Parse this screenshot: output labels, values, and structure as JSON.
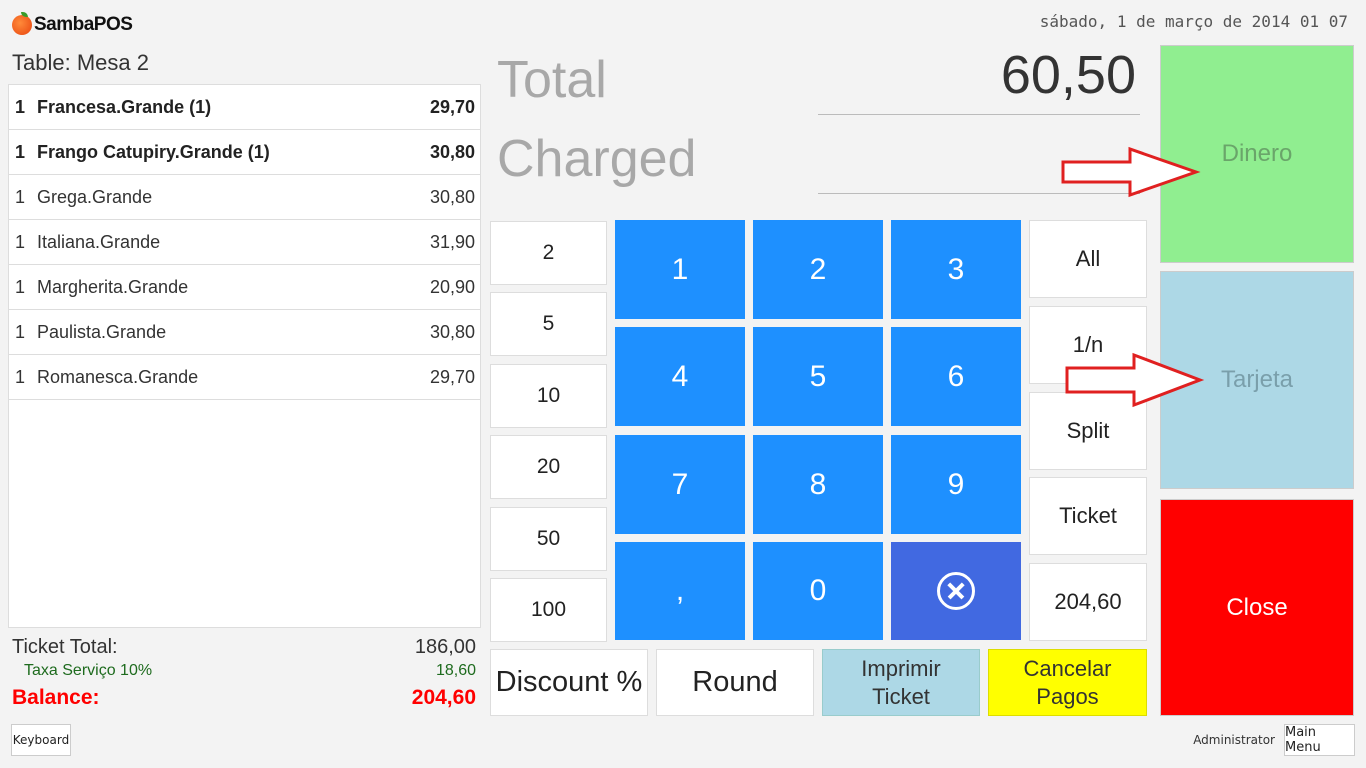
{
  "app": {
    "name": "SambaPOS",
    "datetime": "sábado, 1 de março de 2014 01 07"
  },
  "ticket": {
    "table_label": "Table: Mesa 2",
    "items": [
      {
        "qty": "1",
        "name": "Francesa.Grande (1)",
        "price": "29,70",
        "bold": true
      },
      {
        "qty": "1",
        "name": "Frango Catupiry.Grande (1)",
        "price": "30,80",
        "bold": true
      },
      {
        "qty": "1",
        "name": "Grega.Grande",
        "price": "30,80",
        "bold": false
      },
      {
        "qty": "1",
        "name": "Italiana.Grande",
        "price": "31,90",
        "bold": false
      },
      {
        "qty": "1",
        "name": "Margherita.Grande",
        "price": "20,90",
        "bold": false
      },
      {
        "qty": "1",
        "name": "Paulista.Grande",
        "price": "30,80",
        "bold": false
      },
      {
        "qty": "1",
        "name": "Romanesca.Grande",
        "price": "29,70",
        "bold": false
      }
    ],
    "ticket_total_label": "Ticket Total:",
    "ticket_total_value": "186,00",
    "tax_label": "Taxa Serviço 10%",
    "tax_value": "18,60",
    "balance_label": "Balance:",
    "balance_value": "204,60"
  },
  "payment": {
    "total_label": "Total",
    "total_value": "60,50",
    "charged_label": "Charged",
    "charged_value": ""
  },
  "quick_amounts": [
    "2",
    "5",
    "10",
    "20",
    "50",
    "100"
  ],
  "numpad": [
    "1",
    "2",
    "3",
    "4",
    "5",
    "6",
    "7",
    "8",
    "9",
    ",",
    "0"
  ],
  "side_buttons": [
    "All",
    "1/n",
    "Split",
    "Ticket",
    "204,60"
  ],
  "payment_types": {
    "cash": "Dinero",
    "card": "Tarjeta",
    "close": "Close"
  },
  "bottom_buttons": {
    "discount": "Discount %",
    "round": "Round",
    "print_line1": "Imprimir",
    "print_line2": "Ticket",
    "cancel_line1": "Cancelar",
    "cancel_line2": "Pagos"
  },
  "footer": {
    "keyboard": "Keyboard",
    "user": "Administrator",
    "main_menu": "Main Menu"
  },
  "colors": {
    "numpad_blue": "#1e90ff",
    "clear_blue": "#4169e1",
    "cash_green": "#90ee90",
    "card_blue": "#add8e6",
    "close_red": "#ff0000",
    "cancel_yellow": "#ffff00",
    "print_blue": "#add8e6",
    "balance_red": "#ff0000",
    "annotation_arrow": "#e02020"
  },
  "icons": {
    "clear": "circle-x-icon",
    "logo": "sambapos-logo-icon",
    "annotation": "red-arrow-icon"
  }
}
